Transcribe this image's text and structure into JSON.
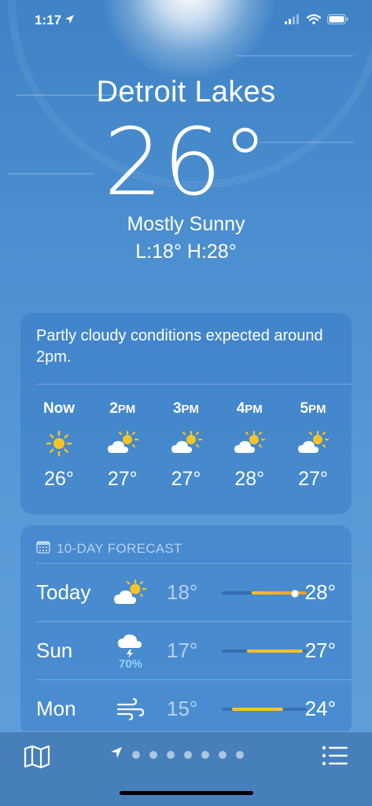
{
  "status_bar": {
    "time": "1:17"
  },
  "location": {
    "city": "Detroit Lakes",
    "temperature": "26°",
    "condition": "Mostly Sunny",
    "low_high": "L:18° H:28°"
  },
  "hourly": {
    "summary": "Partly cloudy conditions expected around 2pm.",
    "items": [
      {
        "hour": "Now",
        "suffix": "",
        "icon": "sun-icon",
        "temp": "26°"
      },
      {
        "hour": "2",
        "suffix": "PM",
        "icon": "partly-cloudy-icon",
        "temp": "27°"
      },
      {
        "hour": "3",
        "suffix": "PM",
        "icon": "partly-cloudy-icon",
        "temp": "27°"
      },
      {
        "hour": "4",
        "suffix": "PM",
        "icon": "partly-cloudy-icon",
        "temp": "28°"
      },
      {
        "hour": "5",
        "suffix": "PM",
        "icon": "partly-cloudy-icon",
        "temp": "27°"
      }
    ]
  },
  "daily": {
    "title": "10-DAY FORECAST",
    "days": [
      {
        "day": "Today",
        "icon": "partly-cloudy-icon",
        "precip": "",
        "low": "18°",
        "high": "28°",
        "range_start": 0.35,
        "range_end": 1.0,
        "current": 0.85
      },
      {
        "day": "Sun",
        "icon": "thunderstorm-icon",
        "precip": "70%",
        "low": "17°",
        "high": "27°",
        "range_start": 0.3,
        "range_end": 0.95,
        "current": null
      },
      {
        "day": "Mon",
        "icon": "wind-icon",
        "precip": "",
        "low": "15°",
        "high": "24°",
        "range_start": 0.12,
        "range_end": 0.72,
        "current": null
      }
    ]
  },
  "toolbar": {
    "page_count": 7
  },
  "colors": {
    "accent_yellow": "#f7c325",
    "accent_orange": "#f49a1d",
    "precip_blue": "#8fd3ff"
  }
}
